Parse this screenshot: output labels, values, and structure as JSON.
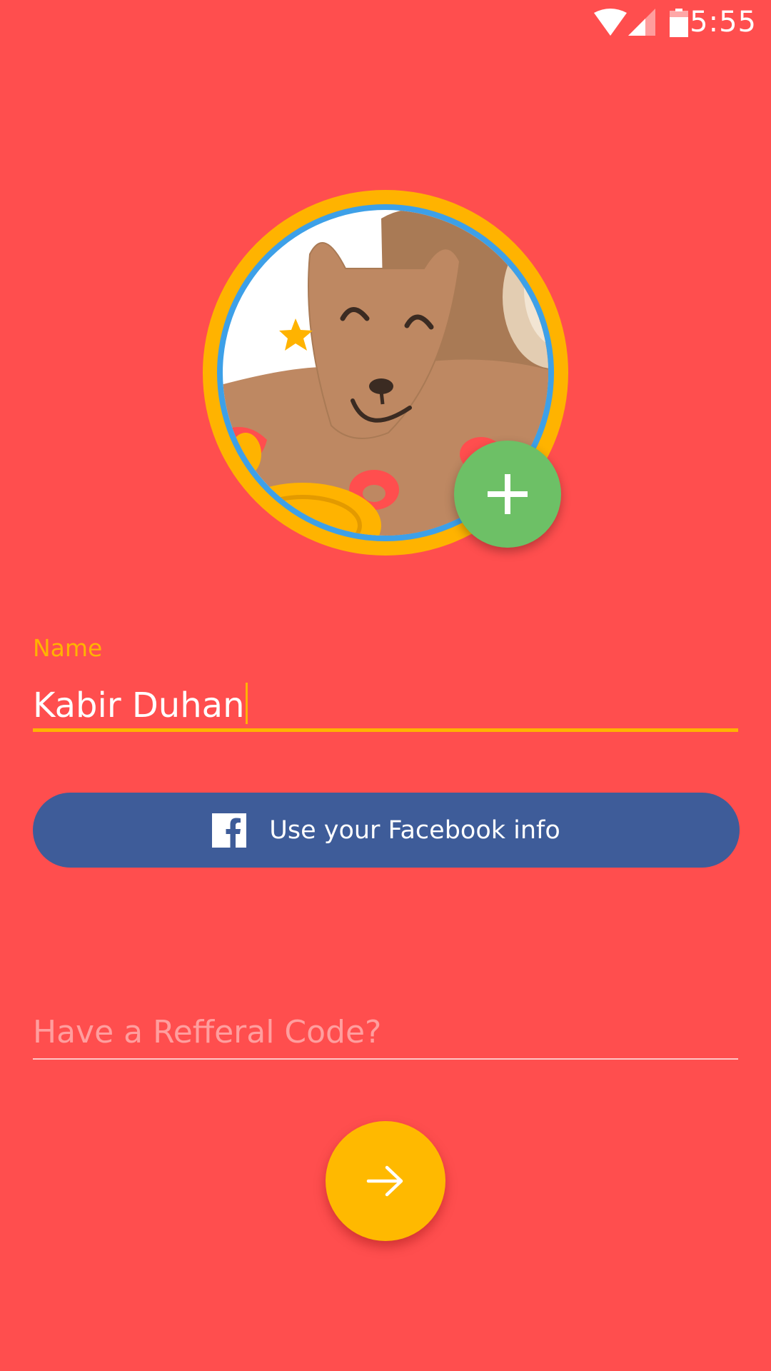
{
  "status_bar": {
    "time": "5:55",
    "icons": [
      "wifi-icon",
      "cellular-signal-icon",
      "battery-icon"
    ]
  },
  "profile": {
    "avatar_icon": "bear-avatar-image",
    "add_photo_icon": "plus-icon"
  },
  "name_field": {
    "label": "Name",
    "value": "Kabir Duhan"
  },
  "facebook_button": {
    "icon": "facebook-icon",
    "label": "Use your Facebook info"
  },
  "referral_field": {
    "placeholder": "Have a Refferal Code?"
  },
  "next_button": {
    "icon": "arrow-right-icon"
  },
  "colors": {
    "background": "#FF4E4E",
    "accent": "#FFB300",
    "facebook": "#3E5C99",
    "add_button": "#6DC066"
  }
}
